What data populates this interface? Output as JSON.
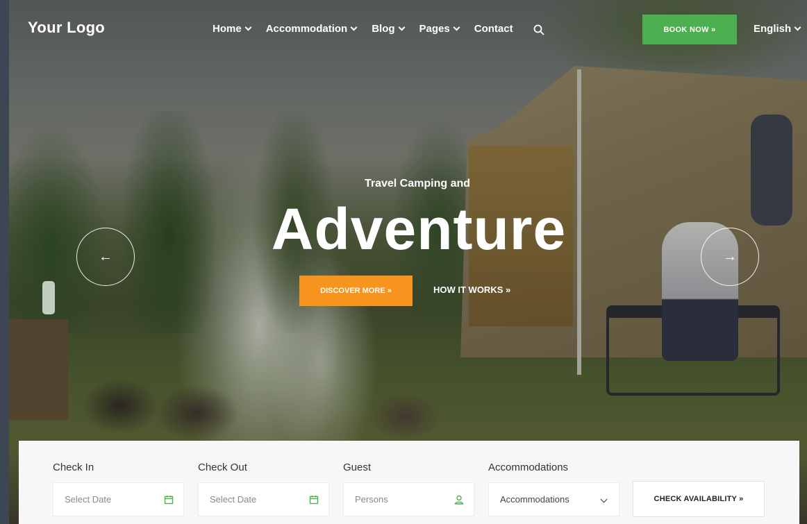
{
  "header": {
    "logo": "Your Logo",
    "nav": [
      {
        "label": "Home",
        "dropdown": true
      },
      {
        "label": "Accommodation",
        "dropdown": true
      },
      {
        "label": "Blog",
        "dropdown": true
      },
      {
        "label": "Pages",
        "dropdown": true
      },
      {
        "label": "Contact",
        "dropdown": false
      }
    ],
    "search_icon": "search-icon",
    "book_button": "BOOK NOW »",
    "language": "English"
  },
  "hero": {
    "subtitle": "Travel Camping and",
    "title": "Adventure",
    "discover_button": "DISCOVER MORE »",
    "how_link": "HOW IT WORKS »",
    "prev_arrow": "←",
    "next_arrow": "→"
  },
  "booking": {
    "check_in": {
      "label": "Check In",
      "placeholder": "Select Date",
      "icon": "calendar-icon"
    },
    "check_out": {
      "label": "Check Out",
      "placeholder": "Select Date",
      "icon": "calendar-icon"
    },
    "guest": {
      "label": "Guest",
      "placeholder": "Persons",
      "icon": "user-icon"
    },
    "accommodations": {
      "label": "Accommodations",
      "selected": "Accommodations"
    },
    "check_button": "CHECK AVAILABILITY »"
  },
  "colors": {
    "book_button": "#4caf50",
    "discover_button": "#f7941d",
    "icon_green": "#4caf50"
  }
}
